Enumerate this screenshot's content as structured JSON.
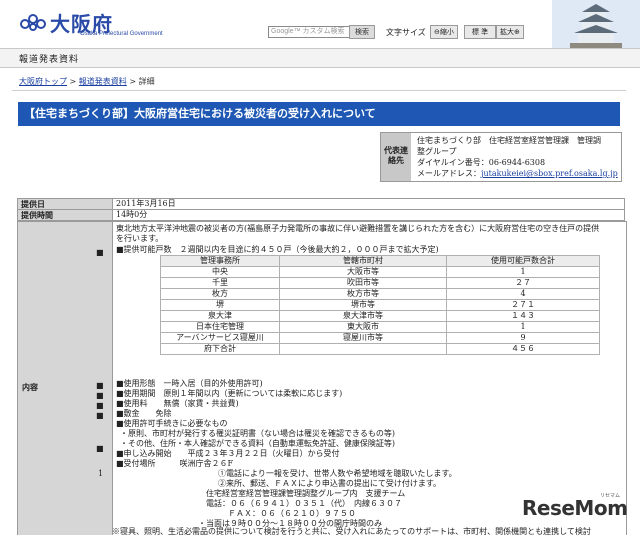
{
  "header": {
    "logo_text": "大阪府",
    "logo_sub": "Osaka Prefectural Government",
    "search_placeholder": "Google™ カスタム検索",
    "search_button": "検索",
    "font_size_label": "文字サイズ",
    "font_small": "縮小",
    "font_standard": "標 準",
    "font_large": "拡大"
  },
  "subbar": {
    "title": "報道発表資料"
  },
  "breadcrumb": {
    "top": "大阪府トップ",
    "sep1": " > ",
    "press": "報道発表資料",
    "sep2": " > ",
    "current": "詳細"
  },
  "title": "【住宅まちづくり部】大阪府営住宅における被災者の受け入れについて",
  "contact": {
    "head": "代表連絡先",
    "line1": "住宅まちづくり部　住宅経営室経営管理課　管理調",
    "line2": "整グループ",
    "line3": "ダイヤルイン番号：06-6944-6308",
    "line4_prefix": "メールアドレス：",
    "line4_link": "jutakukeiei@sbox.pref.osaka.lg.jp"
  },
  "info": {
    "date_label": "提供日",
    "date_value": "2011年3月16日",
    "time_label": "提供時間",
    "time_value": "14時0分",
    "content_label": "内容"
  },
  "content": {
    "intro1": "東北地方太平洋沖地震の被災者の方(福島原子力発電所の事故に伴い避難措置を講じられた方を含む）に大阪府営住宅の空き住戸の提供",
    "intro2": "を行います。",
    "supply": "■提供可能戸数　２週間以内を目途に約４５０戸（今後最大約２，０００戸まで拡大予定)",
    "bullet_mark": "■",
    "item1": "■使用形態　一時入居（目的外使用許可)",
    "item2": "■使用期間　原則１年間以内（更新については柔軟に応じます)",
    "item3": "■使用料　　無償（家賃・共益費)",
    "item4": "■敷金　　免除",
    "item5": "■使用許可手続きに必要なもの",
    "item5a": "・原則、市町村が発行する罹災証明書（ない場合は罹災を確認できるもの等)",
    "item5b": "・その他、住所・本人確認ができる資料（自動車運転免許証、健康保険証等)",
    "item6": "■申し込み開始　　平成２３年３月２２日（火曜日）から受付",
    "item7": "■受付場所　　　咲洲庁舎２６F",
    "item7a": "①電話により一報を受け、世帯人数や希望地域を聴取いたします。",
    "item7b": "②来所、郵送、ＦＡＸにより申込書の提出にて受け付けます。",
    "item7c": "住宅経営室経営管理課管理調整グループ内　支援チーム",
    "item7d": "電話：０６（６９４１）０３５１（代）　内線６３０７",
    "item7e": "ＦＡＸ：０６（６２１０）９７５０",
    "item7f": "・当面は９時００分～１８時００分の開庁時間のみ",
    "note": "※寝具、照明、生活必需品の提供について検討を行うと共に、受け入れにあたってのサポートは、市町村、関係機関とも連携して検討",
    "number1": "1"
  },
  "table": {
    "headers": [
      "管理事務所",
      "管轄市町村",
      "使用可能戸数合計"
    ],
    "rows": [
      [
        "中央",
        "大阪市等",
        "1"
      ],
      [
        "千里",
        "吹田市等",
        "２７"
      ],
      [
        "枚方",
        "枚方市等",
        "4"
      ],
      [
        "堺",
        "堺市等",
        "２７１"
      ],
      [
        "泉大津",
        "泉大津市等",
        "１４３"
      ],
      [
        "日本住宅管理",
        "東大阪市",
        "1"
      ],
      [
        "アーバンサービス寝屋川",
        "寝屋川市等",
        "9"
      ],
      [
        "府下合計",
        "",
        "４５６"
      ]
    ]
  },
  "watermark": {
    "text": "ReseMom",
    "small": "リセマム"
  },
  "colors": {
    "title_bar": "#1e58b4",
    "label_bg": "#d6d6d6",
    "logo": "#2a4aa8"
  }
}
